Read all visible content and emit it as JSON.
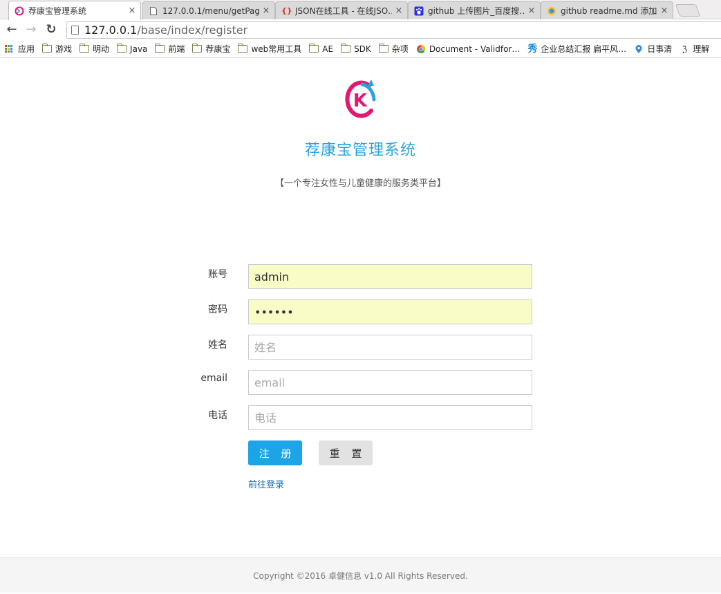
{
  "browser": {
    "tabs": [
      {
        "title": "荐康宝管理系统",
        "icon": "app-favicon",
        "active": true
      },
      {
        "title": "127.0.0.1/menu/getPag…",
        "icon": "page-icon",
        "active": false
      },
      {
        "title": "JSON在线工具 - 在线JSO…",
        "icon": "braces-icon",
        "active": false
      },
      {
        "title": "github 上传图片_百度搜…",
        "icon": "paw-icon",
        "active": false
      },
      {
        "title": "github readme.md 添加…",
        "icon": "shield-favicon",
        "active": false
      }
    ],
    "close_glyph": "×",
    "nav": {
      "back": "←",
      "forward": "→",
      "reload": "↻"
    },
    "url_host": "127.0.0.1",
    "url_path": "/base/index/register",
    "bookmarks": [
      {
        "label": "应用",
        "icon": "apps-icon"
      },
      {
        "label": "游戏",
        "icon": "folder-icon"
      },
      {
        "label": "明动",
        "icon": "folder-icon"
      },
      {
        "label": "Java",
        "icon": "folder-icon"
      },
      {
        "label": "前端",
        "icon": "folder-icon"
      },
      {
        "label": "荐康宝",
        "icon": "folder-icon"
      },
      {
        "label": "web常用工具",
        "icon": "folder-icon"
      },
      {
        "label": "AE",
        "icon": "folder-icon"
      },
      {
        "label": "SDK",
        "icon": "folder-icon"
      },
      {
        "label": "杂项",
        "icon": "folder-icon"
      },
      {
        "label": "Document - Validfor…",
        "icon": "chrome-icon"
      },
      {
        "label": "企业总结汇报 扁平风…",
        "icon": "xiu-icon"
      },
      {
        "label": "日事清",
        "icon": "pin-icon"
      },
      {
        "label": "理解",
        "icon": "script-icon"
      }
    ]
  },
  "page": {
    "system_title": "荐康宝管理系统",
    "subtitle": "【一个专注女性与儿童健康的服务类平台】",
    "logo_letter": "K",
    "colors": {
      "brand_blue": "#2aa3dc",
      "brand_pink": "#e5176f",
      "primary_button": "#1ba5e6",
      "link": "#1769b2"
    },
    "form": {
      "account": {
        "label": "账号",
        "value": "admin"
      },
      "password": {
        "label": "密码",
        "value": "123456"
      },
      "name": {
        "label": "姓名",
        "placeholder": "姓名"
      },
      "email": {
        "label": "email",
        "placeholder": "email"
      },
      "phone": {
        "label": "电话",
        "placeholder": "电话"
      }
    },
    "register_button": "注 册",
    "reset_button": "重 置",
    "login_link": "前往登录",
    "footer": "Copyright ©2016 卓健信息 v1.0 All Rights Reserved."
  }
}
